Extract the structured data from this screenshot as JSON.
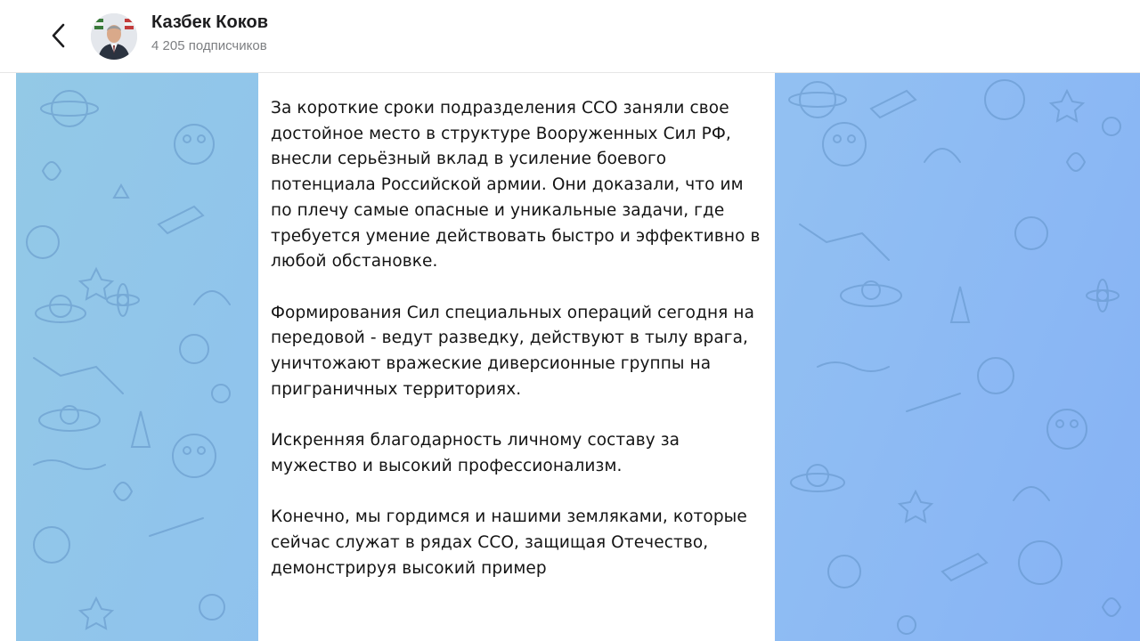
{
  "header": {
    "back_icon": "chevron-left-icon",
    "avatar_icon": "channel-avatar-photo",
    "channel_name": "Казбек Коков",
    "subscribers": "4 205 подписчиков"
  },
  "colors": {
    "background_start": "#93c9e6",
    "background_end": "#86b2f5",
    "message_bubble": "#ffffff",
    "text": "#141414",
    "subtext": "#7d7f82"
  },
  "message": {
    "paragraphs": [
      "За короткие сроки подразделения ССО заняли свое достойное место в структуре Вооруженных Сил РФ, внесли серьёзный вклад в усиление боевого потенциала Российской армии. Они доказали, что им по плечу самые опасные и уникальные задачи, где требуется умение действовать быстро и эффективно в любой обстановке.",
      "Формирования Сил специальных операций сегодня на передовой - ведут разведку, действуют в тылу врага, уничтожают вражеские диверсионные группы на приграничных территориях.",
      "Искренняя благодарность личному составу за мужество и высокий профессионализм.",
      "Конечно, мы гордимся и нашими земляками, которые сейчас служат в рядах ССО, защищая Отечество, демонстрируя высокий пример"
    ]
  }
}
